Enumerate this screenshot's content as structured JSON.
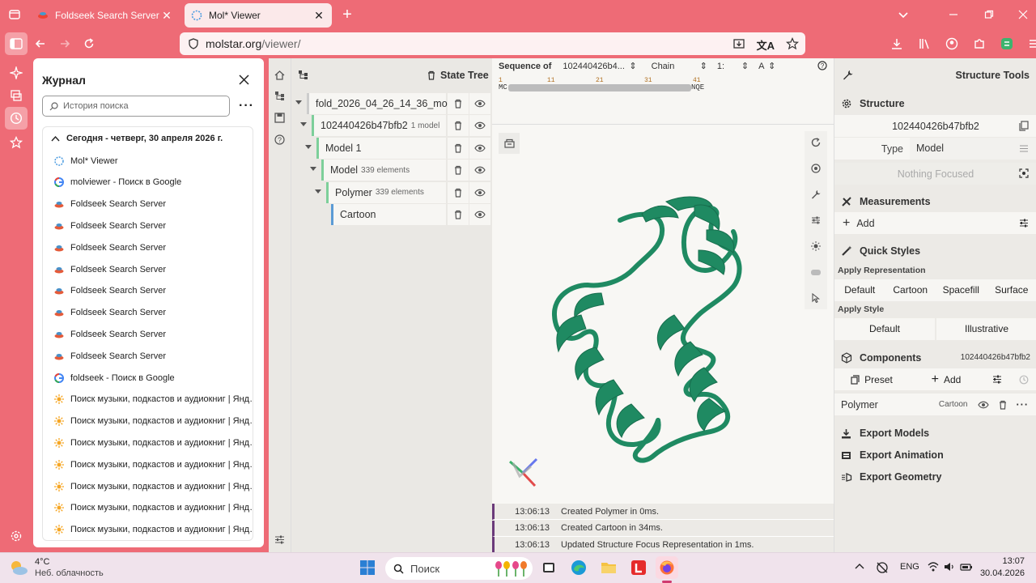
{
  "tabs": [
    {
      "title": "Foldseek Search Server",
      "active": false
    },
    {
      "title": "Mol* Viewer",
      "active": true
    }
  ],
  "url": {
    "domain": "molstar.org",
    "path": "/viewer/"
  },
  "history": {
    "title": "Журнал",
    "search_placeholder": "История поиска",
    "group_label": "Сегодня - четверг, 30 апреля 2026 г.",
    "items": [
      {
        "label": "Mol* Viewer",
        "icon": "molstar-icon"
      },
      {
        "label": "molviewer - Поиск в Google",
        "icon": "google-icon"
      },
      {
        "label": "Foldseek Search Server",
        "icon": "foldseek-icon"
      },
      {
        "label": "Foldseek Search Server",
        "icon": "foldseek-icon"
      },
      {
        "label": "Foldseek Search Server",
        "icon": "foldseek-icon"
      },
      {
        "label": "Foldseek Search Server",
        "icon": "foldseek-icon"
      },
      {
        "label": "Foldseek Search Server",
        "icon": "foldseek-icon"
      },
      {
        "label": "Foldseek Search Server",
        "icon": "foldseek-icon"
      },
      {
        "label": "Foldseek Search Server",
        "icon": "foldseek-icon"
      },
      {
        "label": "Foldseek Search Server",
        "icon": "foldseek-icon"
      },
      {
        "label": "foldseek - Поиск в Google",
        "icon": "google-icon"
      },
      {
        "label": "Поиск музыки, подкастов и аудиокниг | Янде...",
        "icon": "yandex-icon"
      },
      {
        "label": "Поиск музыки, подкастов и аудиокниг | Янде...",
        "icon": "yandex-icon"
      },
      {
        "label": "Поиск музыки, подкастов и аудиокниг | Янде...",
        "icon": "yandex-icon"
      },
      {
        "label": "Поиск музыки, подкастов и аудиокниг | Янде...",
        "icon": "yandex-icon"
      },
      {
        "label": "Поиск музыки, подкастов и аудиокниг | Янде...",
        "icon": "yandex-icon"
      },
      {
        "label": "Поиск музыки, подкастов и аудиокниг | Янде...",
        "icon": "yandex-icon"
      },
      {
        "label": "Поиск музыки, подкастов и аудиокниг | Янде...",
        "icon": "yandex-icon"
      }
    ]
  },
  "state_tree": {
    "title": "State Tree",
    "nodes": [
      {
        "label": "fold_2026_04_26_14_36_mo...",
        "sub": "",
        "accent": "#cccccc"
      },
      {
        "label": "102440426b47bfb2",
        "sub": "1 model",
        "accent": "#7dcf9a"
      },
      {
        "label": "Model 1",
        "sub": "",
        "accent": "#7dcf9a"
      },
      {
        "label": "Model",
        "sub": "339 elements",
        "accent": "#7dcf9a"
      },
      {
        "label": "Polymer",
        "sub": "339 elements",
        "accent": "#7dcf9a"
      },
      {
        "label": "Cartoon",
        "sub": "",
        "accent": "#5b9bd5"
      }
    ]
  },
  "sequence": {
    "label": "Sequence of",
    "entity": "102440426b4...",
    "chain_label": "Chain",
    "chain_value": "1:",
    "chain_id": "A",
    "ruler": [
      "1",
      "11",
      "21",
      "31",
      "41"
    ],
    "start": "MC",
    "end": "NQE"
  },
  "log": [
    {
      "time": "13:06:13",
      "message": "Created Polymer in 0ms."
    },
    {
      "time": "13:06:13",
      "message": "Created Cartoon in 34ms."
    },
    {
      "time": "13:06:13",
      "message": "Updated Structure Focus Representation in 1ms."
    }
  ],
  "structure_tools": {
    "title": "Structure Tools",
    "structure": {
      "title": "Structure",
      "id": "102440426b47bfb2",
      "type_label": "Type",
      "type_value": "Model",
      "focus": "Nothing Focused"
    },
    "measurements": {
      "title": "Measurements",
      "add": "Add"
    },
    "quick_styles": {
      "title": "Quick Styles",
      "apply_representation": "Apply Representation",
      "representations": [
        "Default",
        "Cartoon",
        "Spacefill",
        "Surface"
      ],
      "apply_style": "Apply Style",
      "styles": [
        "Default",
        "Illustrative"
      ]
    },
    "components": {
      "title": "Components",
      "id": "102440426b47bfb2",
      "preset": "Preset",
      "add": "Add",
      "polymer": "Polymer",
      "polymer_repr": "Cartoon"
    },
    "exports": [
      "Export Models",
      "Export Animation",
      "Export Geometry"
    ]
  },
  "taskbar": {
    "weather_temp": "4°C",
    "weather_desc": "Неб. облачность",
    "search": "Поиск",
    "lang": "ENG",
    "time": "13:07",
    "date": "30.04.2026"
  },
  "colors": {
    "accent": "#ee6b76",
    "protein": "#1f8a62"
  }
}
